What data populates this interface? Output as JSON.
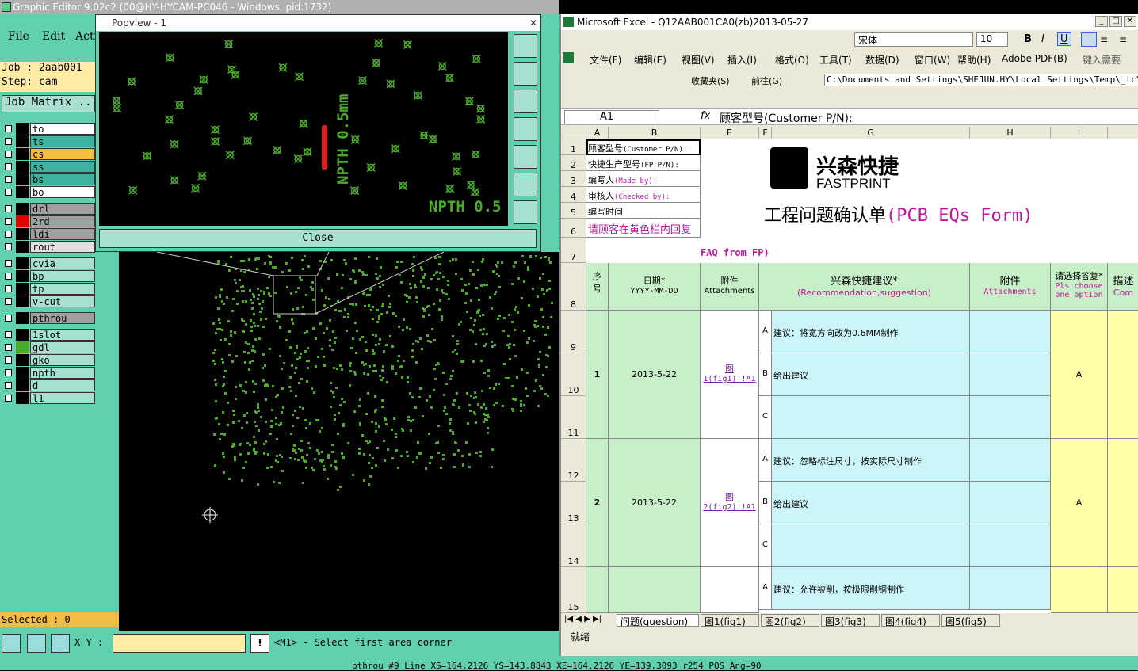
{
  "ge": {
    "title": "Graphic Editor 9.02c2 (00@HY-HYCAM-PC046 - Windows, pid:1732)",
    "menus": [
      "File",
      "Edit",
      "Acti"
    ],
    "job": "Job : 2aab001",
    "step": "Step: cam",
    "job_matrix": "Job Matrix ..",
    "layers": [
      {
        "name": "to",
        "bg": "#ffffff",
        "sw": "#000000"
      },
      {
        "name": "ts",
        "bg": "#3cb4a0",
        "sw": "#000000"
      },
      {
        "name": "cs",
        "bg": "#f5bc40",
        "sw": "#000000"
      },
      {
        "name": "ss",
        "bg": "#3cb4a0",
        "sw": "#000000"
      },
      {
        "name": "bs",
        "bg": "#3cb4a0",
        "sw": "#000000"
      },
      {
        "name": "bo",
        "bg": "#ffffff",
        "sw": "#000000"
      },
      {
        "name": "drl",
        "bg": "#a0a0a0",
        "sw": "#000000"
      },
      {
        "name": "2rd",
        "bg": "#a0a0a0",
        "sw": "#e00000"
      },
      {
        "name": "ldi",
        "bg": "#a0a0a0",
        "sw": "#000000"
      },
      {
        "name": "rout",
        "bg": "#e0e0e0",
        "sw": "#000000"
      },
      {
        "name": "cvia",
        "bg": "#a8e0d2",
        "sw": "#000000"
      },
      {
        "name": "bp",
        "bg": "#a8e0d2",
        "sw": "#000000"
      },
      {
        "name": "tp",
        "bg": "#a8e0d2",
        "sw": "#000000"
      },
      {
        "name": "v-cut",
        "bg": "#a8e0d2",
        "sw": "#000000"
      },
      {
        "name": "pthrou",
        "bg": "#a0a0a0",
        "sw": "#000000"
      },
      {
        "name": "1slot",
        "bg": "#a8e0d2",
        "sw": "#000000"
      },
      {
        "name": "gdl",
        "bg": "#a8e0d2",
        "sw": "#4caa2a"
      },
      {
        "name": "gko",
        "bg": "#a8e0d2",
        "sw": "#000000"
      },
      {
        "name": "npth",
        "bg": "#a8e0d2",
        "sw": "#000000"
      },
      {
        "name": "d",
        "bg": "#a8e0d2",
        "sw": "#000000"
      },
      {
        "name": "l1",
        "bg": "#a8e0d2",
        "sw": "#000000"
      }
    ],
    "selected": "Selected : 0",
    "xy_label": "X Y :",
    "prompt": "<M1> - Select first area corner",
    "status": "pthrou #9 Line XS=164.2126 YS=143.8843 XE=164.2126 YE=139.3093 r254 POS Ang=90"
  },
  "popview": {
    "title": "Popview - 1",
    "close_label": "Close",
    "npth_vertical": "NPTH 0.5mm",
    "npth_bottom": "NPTH 0.5"
  },
  "excel": {
    "title": "Microsoft Excel - Q12AAB001CA0(zb)2013-05-27",
    "font": "宋体",
    "font_size": "10",
    "menus": [
      "文件(F)",
      "编辑(E)",
      "视图(V)",
      "插入(I)",
      "格式(O)",
      "工具(T)",
      "数据(D)",
      "窗口(W)",
      "帮助(H)",
      "Adobe PDF(B)"
    ],
    "help_hint": "键入需要",
    "favorites": "收藏夹(S)",
    "goto": "前往(G)",
    "address": "C:\\Documents and Settings\\SHEJUN.HY\\Local Settings\\Temp\\_tc\\Q12AA",
    "name_box": "A1",
    "fx": "fx",
    "formula": "顾客型号(Customer P/N):",
    "columns": [
      "A",
      "B",
      "E",
      "F",
      "G",
      "H",
      "I"
    ],
    "info": [
      {
        "cn": "顾客型号",
        "en": "(Customer P/N):"
      },
      {
        "cn": "快捷生产型号",
        "en": "(FP P/N):"
      },
      {
        "cn": "编写人",
        "en": "(Made by):"
      },
      {
        "cn": "审核人",
        "en": "(Checked by):"
      },
      {
        "cn": "编写时间",
        "en": ""
      },
      {
        "cn": "请顾客在黄色栏内回复",
        "en": ""
      }
    ],
    "logo_cn": "兴森快捷",
    "logo_en": "FASTPRINT",
    "form_title_cn": "工程问题确认单",
    "form_title_en": "(PCB EQs Form)",
    "faq": "FAQ from FP)",
    "hdr_seq_1": "序",
    "hdr_seq_2": "号",
    "hdr_date": "日期*",
    "hdr_date_fmt": "YYYY-MM-DD",
    "hdr_att": "附件",
    "hdr_att_en": "Attachments",
    "hdr_rec": "兴森快捷建议*",
    "hdr_rec_en": "(Recommendation,suggestion)",
    "hdr_att2": "附件",
    "hdr_att2_en": "Attachments",
    "hdr_choose": "请选择答复*",
    "hdr_choose_en1": "Pls choose",
    "hdr_choose_en2": "one option",
    "hdr_desc": "描述",
    "hdr_desc_en": "Com",
    "items": [
      {
        "no": "1",
        "date": "2013-5-22",
        "fig_link": "图",
        "fig_ref": "1(fig1)'!A1",
        "answer": "A",
        "options": [
          {
            "l": "A",
            "t": "建议：将宽方向改为0.6MM制作"
          },
          {
            "l": "B",
            "t": "给出建议"
          },
          {
            "l": "C",
            "t": ""
          }
        ]
      },
      {
        "no": "2",
        "date": "2013-5-22",
        "fig_link": "图",
        "fig_ref": "2(fig2)'!A1",
        "answer": "A",
        "options": [
          {
            "l": "A",
            "t": "建议：忽略标注尺寸，按实际尺寸制作"
          },
          {
            "l": "B",
            "t": "给出建议"
          },
          {
            "l": "C",
            "t": ""
          }
        ]
      },
      {
        "no": "",
        "date": "",
        "fig_link": "",
        "fig_ref": "",
        "answer": "",
        "options": [
          {
            "l": "A",
            "t": "建议：允许被削，按极限削铜制作"
          }
        ]
      }
    ],
    "sheet_tabs": [
      "问题(question)",
      "图1(fig1)",
      "图2(fig2)",
      "图3(fig3)",
      "图4(fig4)",
      "图5(fig5)"
    ],
    "status": "就绪"
  }
}
